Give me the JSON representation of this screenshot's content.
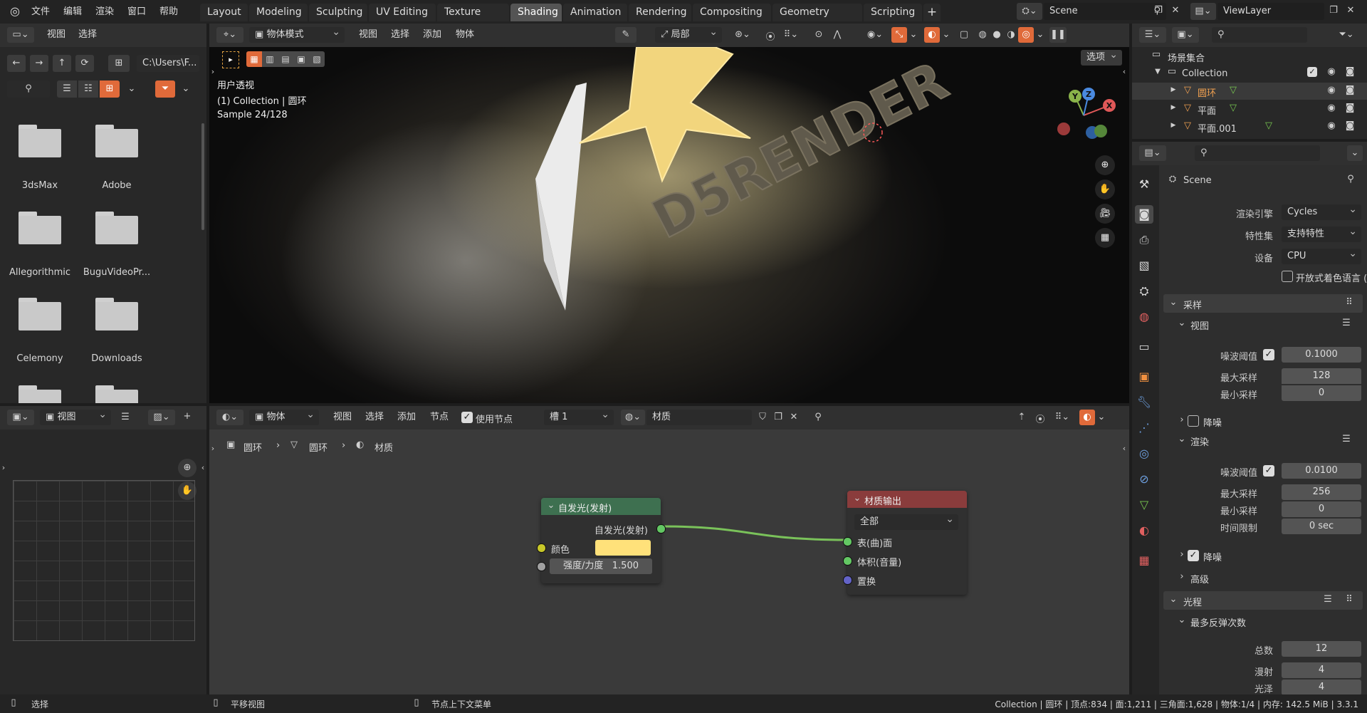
{
  "topbar": {
    "menus": [
      "文件",
      "编辑",
      "渲染",
      "窗口",
      "帮助"
    ],
    "tabs": [
      "Layout",
      "Modeling",
      "Sculpting",
      "UV Editing",
      "Texture Paint",
      "Shading",
      "Animation",
      "Rendering",
      "Compositing",
      "Geometry Nodes",
      "Scripting"
    ],
    "active_tab": "Shading",
    "scene": "Scene",
    "viewlayer": "ViewLayer"
  },
  "filebrowser": {
    "menus": [
      "视图",
      "选择"
    ],
    "path": "C:\\Users\\F...",
    "folders": [
      "3dsMax",
      "Adobe",
      "Allegorithmic",
      "BuguVideoPr...",
      "Celemony",
      "Downloads"
    ]
  },
  "viewport": {
    "mode": "物体模式",
    "menus": [
      "视图",
      "选择",
      "添加",
      "物体"
    ],
    "transform": "局部",
    "options": "选项",
    "overlay_lines": [
      "用户透视",
      "(1) Collection | 圆环",
      "Sample 24/128"
    ],
    "scene_text": "D5RENDER",
    "gizmo": {
      "x": "X",
      "y": "Y",
      "z": "Z"
    }
  },
  "image_editor": {
    "menu": "视图"
  },
  "node_editor": {
    "object": "物体",
    "menus": [
      "视图",
      "选择",
      "添加",
      "节点"
    ],
    "use_nodes": "使用节点",
    "slot": "槽 1",
    "material": "材质",
    "breadcrumb": [
      "圆环",
      "圆环",
      "材质"
    ],
    "emission": {
      "title": "自发光(发射)",
      "output": "自发光(发射)",
      "color_label": "颜色",
      "color": "#ffe17a",
      "strength_label": "强度/力度",
      "strength": "1.500"
    },
    "output_node": {
      "title": "材质输出",
      "target": "全部",
      "sockets": [
        "表(曲)面",
        "体积(音量)",
        "置换"
      ]
    }
  },
  "outliner": {
    "root": "场景集合",
    "collection": "Collection",
    "items": [
      "圆环",
      "平面",
      "平面.001"
    ]
  },
  "properties": {
    "context": "Scene",
    "render_engine_label": "渲染引擎",
    "render_engine": "Cycles",
    "feature_label": "特性集",
    "feature": "支持特性",
    "device_label": "设备",
    "device": "CPU",
    "osl": "开放式着色语言 (OSL)",
    "sampling": "采样",
    "viewport_sub": "视图",
    "noise_label": "噪波阈值",
    "vp_noise": "0.1000",
    "max_label": "最大采样",
    "vp_max": "128",
    "min_label": "最小采样",
    "vp_min": "0",
    "denoise": "降噪",
    "render_sub": "渲染",
    "r_noise": "0.0100",
    "r_max": "256",
    "r_min": "0",
    "time_label": "时间限制",
    "r_time": "0 sec",
    "advanced": "高级",
    "light_paths": "光程",
    "max_bounces": "最多反弹次数",
    "total_label": "总数",
    "total": "12",
    "diffuse_label": "漫射",
    "diffuse": "4",
    "glossy_label": "光泽",
    "glossy": "4"
  },
  "statusbar": {
    "select": "选择",
    "pan": "平移视图",
    "context_menu": "节点上下文菜单",
    "stats": "Collection | 圆环 | 顶点:834 | 面:1,211 | 三角面:1,628 | 物体:1/4 | 内存: 142.5 MiB | 3.3.1"
  }
}
